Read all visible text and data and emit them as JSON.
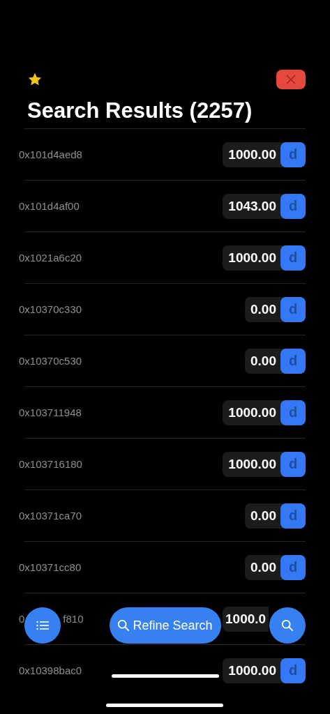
{
  "header": {
    "favorite": true,
    "title": "Search Results (2257)"
  },
  "rows": [
    {
      "kind": "full",
      "address": "0x101d4aed8",
      "value": "1000.00",
      "button": "d"
    },
    {
      "kind": "full",
      "address": "0x101d4af00",
      "value": "1043.00",
      "button": "d"
    },
    {
      "kind": "full",
      "address": "0x1021a6c20",
      "value": "1000.00",
      "button": "d"
    },
    {
      "kind": "full",
      "address": "0x10370c330",
      "value": "0.00",
      "button": "d"
    },
    {
      "kind": "full",
      "address": "0x10370c530",
      "value": "0.00",
      "button": "d"
    },
    {
      "kind": "full",
      "address": "0x103711948",
      "value": "1000.00",
      "button": "d"
    },
    {
      "kind": "full",
      "address": "0x103716180",
      "value": "1000.00",
      "button": "d"
    },
    {
      "kind": "full",
      "address": "0x10371ca70",
      "value": "0.00",
      "button": "d"
    },
    {
      "kind": "full",
      "address": "0x10371cc80",
      "value": "0.00",
      "button": "d"
    },
    {
      "kind": "covered",
      "address_start": "0",
      "address_end": "f810",
      "value": "1000.0"
    },
    {
      "kind": "full",
      "address": "0x10398bac0",
      "value": "1000.00",
      "button": "d"
    }
  ],
  "toolbar": {
    "refine_label": "Refine Search"
  }
}
